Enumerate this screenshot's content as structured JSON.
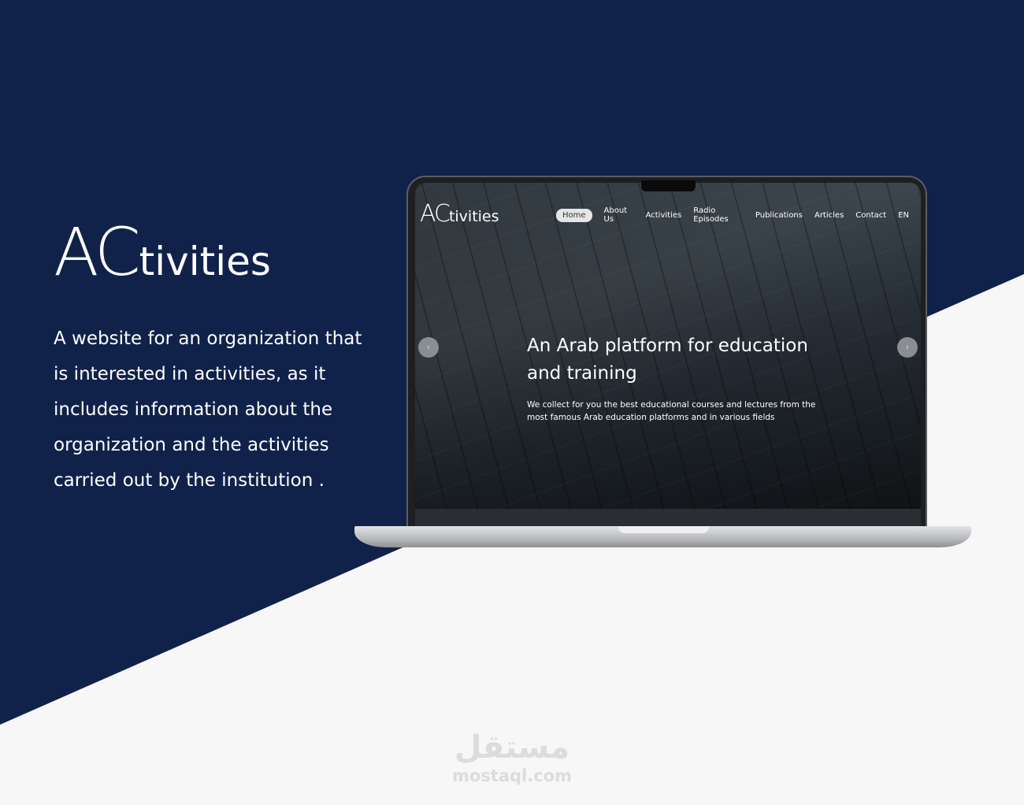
{
  "colors": {
    "navy": "#10224a",
    "light": "#f7f7f7"
  },
  "brand": {
    "big": "AC",
    "small": "tivities"
  },
  "description": "A website for an organization that is interested in activities, as it includes information about the organization and the activities carried out by the institution .",
  "site": {
    "logo_big": "AC",
    "logo_small": "tivities",
    "nav": [
      "Home",
      "About Us",
      "Activities",
      "Radio Episodes",
      "Publications",
      "Articles",
      "Contact",
      "EN"
    ],
    "active_nav": "Home",
    "hero_title": "An Arab platform for education and training",
    "hero_text": "We collect for you the best educational courses and lectures from the most famous Arab education platforms and in various fields",
    "prev": "‹",
    "next": "›"
  },
  "watermark": {
    "arabic": "مستقل",
    "latin": "mostaql.com"
  }
}
